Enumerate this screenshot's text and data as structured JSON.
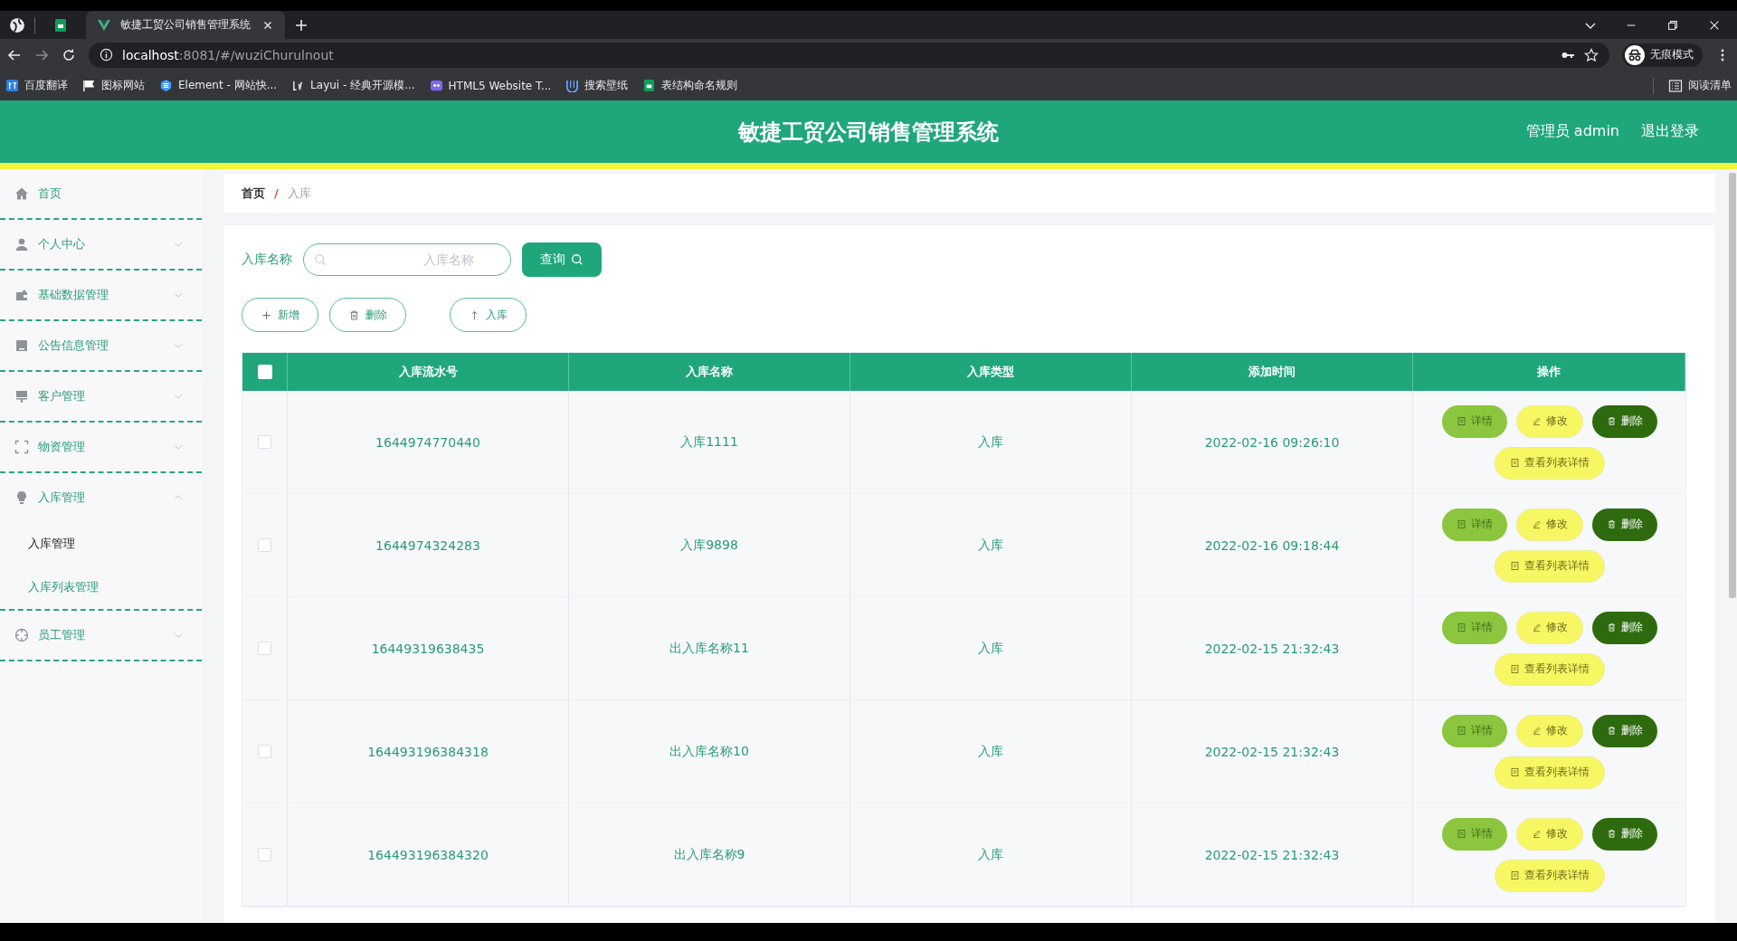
{
  "browser": {
    "tabs": [
      {
        "title": "敏捷工贸公司销售管理系统",
        "selected": true
      }
    ],
    "url_host": "localhost",
    "url_rest": ":8081/#/wuziChurulnout",
    "profile_label": "无痕模式",
    "bookmarks": [
      {
        "label": "百度翻译",
        "kind": "translate"
      },
      {
        "label": "图标网站",
        "kind": "flag"
      },
      {
        "label": "Element - 网站快...",
        "kind": "element"
      },
      {
        "label": "Layui - 经典开源模...",
        "kind": "layui"
      },
      {
        "label": "HTML5 Website T...",
        "kind": "html5"
      },
      {
        "label": "搜索壁纸",
        "kind": "wallpaper"
      },
      {
        "label": "表结构命名规则",
        "kind": "sheet"
      }
    ],
    "reading_list": "阅读清单"
  },
  "header": {
    "title": "敏捷工贸公司销售管理系统",
    "user": "管理员 admin",
    "logout": "退出登录"
  },
  "sidebar": {
    "items": [
      {
        "label": "首页",
        "kind": "link"
      },
      {
        "label": "个人中心",
        "kind": "group",
        "expanded": false
      },
      {
        "label": "基础数据管理",
        "kind": "group",
        "expanded": false
      },
      {
        "label": "公告信息管理",
        "kind": "group",
        "expanded": false
      },
      {
        "label": "客户管理",
        "kind": "group",
        "expanded": false
      },
      {
        "label": "物资管理",
        "kind": "group",
        "expanded": false
      },
      {
        "label": "入库管理",
        "kind": "group",
        "expanded": true,
        "children": [
          {
            "label": "入库管理",
            "selected": true
          },
          {
            "label": "入库列表管理",
            "selected": false
          }
        ]
      },
      {
        "label": "员工管理",
        "kind": "group",
        "expanded": false
      }
    ]
  },
  "breadcrumb": {
    "separator": "/",
    "items": [
      "首页",
      "入库"
    ]
  },
  "search": {
    "label": "入库名称",
    "placeholder": "入库名称",
    "button": "查询"
  },
  "toolbar": [
    {
      "label": "新增",
      "kind": "add"
    },
    {
      "label": "删除",
      "kind": "delete"
    },
    {
      "label": "入库",
      "kind": "upload"
    }
  ],
  "table": {
    "select_all": false,
    "columns": [
      "入库流水号",
      "入库名称",
      "入库类型",
      "添加时间",
      "操作"
    ],
    "rows": [
      {
        "selected": false,
        "cells": [
          "1644974770440",
          "入库1111",
          "入库",
          "2022-02-16 09:26:10"
        ],
        "actions": [
          {
            "label": "详情",
            "kind": "detail"
          },
          {
            "label": "修改",
            "kind": "edit"
          },
          {
            "label": "删除",
            "kind": "delete"
          },
          {
            "label": "查看列表详情",
            "kind": "list"
          }
        ]
      },
      {
        "selected": false,
        "cells": [
          "1644974324283",
          "入库9898",
          "入库",
          "2022-02-16 09:18:44"
        ],
        "actions": [
          {
            "label": "详情",
            "kind": "detail"
          },
          {
            "label": "修改",
            "kind": "edit"
          },
          {
            "label": "删除",
            "kind": "delete"
          },
          {
            "label": "查看列表详情",
            "kind": "list"
          }
        ]
      },
      {
        "selected": false,
        "cells": [
          "16449319638435",
          "出入库名称11",
          "入库",
          "2022-02-15 21:32:43"
        ],
        "actions": [
          {
            "label": "详情",
            "kind": "detail"
          },
          {
            "label": "修改",
            "kind": "edit"
          },
          {
            "label": "删除",
            "kind": "delete"
          },
          {
            "label": "查看列表详情",
            "kind": "list"
          }
        ]
      },
      {
        "selected": false,
        "cells": [
          "164493196384318",
          "出入库名称10",
          "入库",
          "2022-02-15 21:32:43"
        ],
        "actions": [
          {
            "label": "详情",
            "kind": "detail"
          },
          {
            "label": "修改",
            "kind": "edit"
          },
          {
            "label": "删除",
            "kind": "delete"
          },
          {
            "label": "查看列表详情",
            "kind": "list"
          }
        ]
      },
      {
        "selected": false,
        "cells": [
          "164493196384320",
          "出入库名称9",
          "入库",
          "2022-02-15 21:32:43"
        ],
        "actions": [
          {
            "label": "详情",
            "kind": "detail"
          },
          {
            "label": "修改",
            "kind": "edit"
          },
          {
            "label": "删除",
            "kind": "delete"
          },
          {
            "label": "查看列表详情",
            "kind": "list"
          }
        ]
      }
    ]
  }
}
